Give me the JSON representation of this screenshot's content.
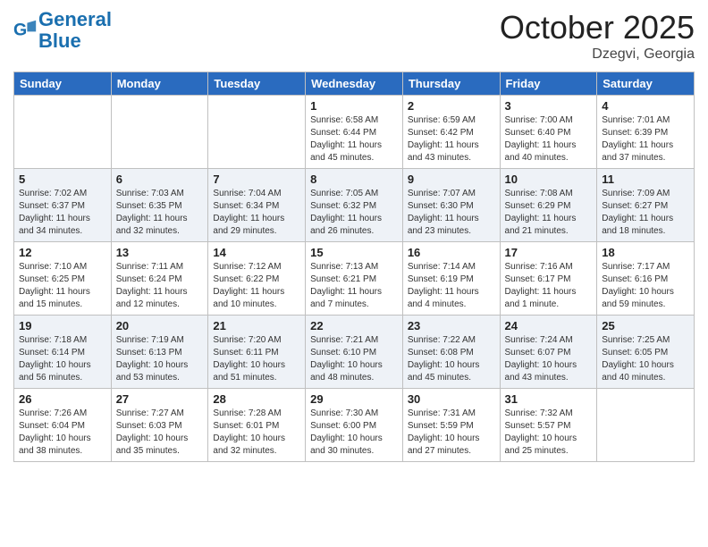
{
  "header": {
    "logo_general": "General",
    "logo_blue": "Blue",
    "month": "October 2025",
    "location": "Dzegvi, Georgia"
  },
  "weekdays": [
    "Sunday",
    "Monday",
    "Tuesday",
    "Wednesday",
    "Thursday",
    "Friday",
    "Saturday"
  ],
  "weeks": [
    [
      {
        "day": "",
        "info": ""
      },
      {
        "day": "",
        "info": ""
      },
      {
        "day": "",
        "info": ""
      },
      {
        "day": "1",
        "info": "Sunrise: 6:58 AM\nSunset: 6:44 PM\nDaylight: 11 hours\nand 45 minutes."
      },
      {
        "day": "2",
        "info": "Sunrise: 6:59 AM\nSunset: 6:42 PM\nDaylight: 11 hours\nand 43 minutes."
      },
      {
        "day": "3",
        "info": "Sunrise: 7:00 AM\nSunset: 6:40 PM\nDaylight: 11 hours\nand 40 minutes."
      },
      {
        "day": "4",
        "info": "Sunrise: 7:01 AM\nSunset: 6:39 PM\nDaylight: 11 hours\nand 37 minutes."
      }
    ],
    [
      {
        "day": "5",
        "info": "Sunrise: 7:02 AM\nSunset: 6:37 PM\nDaylight: 11 hours\nand 34 minutes."
      },
      {
        "day": "6",
        "info": "Sunrise: 7:03 AM\nSunset: 6:35 PM\nDaylight: 11 hours\nand 32 minutes."
      },
      {
        "day": "7",
        "info": "Sunrise: 7:04 AM\nSunset: 6:34 PM\nDaylight: 11 hours\nand 29 minutes."
      },
      {
        "day": "8",
        "info": "Sunrise: 7:05 AM\nSunset: 6:32 PM\nDaylight: 11 hours\nand 26 minutes."
      },
      {
        "day": "9",
        "info": "Sunrise: 7:07 AM\nSunset: 6:30 PM\nDaylight: 11 hours\nand 23 minutes."
      },
      {
        "day": "10",
        "info": "Sunrise: 7:08 AM\nSunset: 6:29 PM\nDaylight: 11 hours\nand 21 minutes."
      },
      {
        "day": "11",
        "info": "Sunrise: 7:09 AM\nSunset: 6:27 PM\nDaylight: 11 hours\nand 18 minutes."
      }
    ],
    [
      {
        "day": "12",
        "info": "Sunrise: 7:10 AM\nSunset: 6:25 PM\nDaylight: 11 hours\nand 15 minutes."
      },
      {
        "day": "13",
        "info": "Sunrise: 7:11 AM\nSunset: 6:24 PM\nDaylight: 11 hours\nand 12 minutes."
      },
      {
        "day": "14",
        "info": "Sunrise: 7:12 AM\nSunset: 6:22 PM\nDaylight: 11 hours\nand 10 minutes."
      },
      {
        "day": "15",
        "info": "Sunrise: 7:13 AM\nSunset: 6:21 PM\nDaylight: 11 hours\nand 7 minutes."
      },
      {
        "day": "16",
        "info": "Sunrise: 7:14 AM\nSunset: 6:19 PM\nDaylight: 11 hours\nand 4 minutes."
      },
      {
        "day": "17",
        "info": "Sunrise: 7:16 AM\nSunset: 6:17 PM\nDaylight: 11 hours\nand 1 minute."
      },
      {
        "day": "18",
        "info": "Sunrise: 7:17 AM\nSunset: 6:16 PM\nDaylight: 10 hours\nand 59 minutes."
      }
    ],
    [
      {
        "day": "19",
        "info": "Sunrise: 7:18 AM\nSunset: 6:14 PM\nDaylight: 10 hours\nand 56 minutes."
      },
      {
        "day": "20",
        "info": "Sunrise: 7:19 AM\nSunset: 6:13 PM\nDaylight: 10 hours\nand 53 minutes."
      },
      {
        "day": "21",
        "info": "Sunrise: 7:20 AM\nSunset: 6:11 PM\nDaylight: 10 hours\nand 51 minutes."
      },
      {
        "day": "22",
        "info": "Sunrise: 7:21 AM\nSunset: 6:10 PM\nDaylight: 10 hours\nand 48 minutes."
      },
      {
        "day": "23",
        "info": "Sunrise: 7:22 AM\nSunset: 6:08 PM\nDaylight: 10 hours\nand 45 minutes."
      },
      {
        "day": "24",
        "info": "Sunrise: 7:24 AM\nSunset: 6:07 PM\nDaylight: 10 hours\nand 43 minutes."
      },
      {
        "day": "25",
        "info": "Sunrise: 7:25 AM\nSunset: 6:05 PM\nDaylight: 10 hours\nand 40 minutes."
      }
    ],
    [
      {
        "day": "26",
        "info": "Sunrise: 7:26 AM\nSunset: 6:04 PM\nDaylight: 10 hours\nand 38 minutes."
      },
      {
        "day": "27",
        "info": "Sunrise: 7:27 AM\nSunset: 6:03 PM\nDaylight: 10 hours\nand 35 minutes."
      },
      {
        "day": "28",
        "info": "Sunrise: 7:28 AM\nSunset: 6:01 PM\nDaylight: 10 hours\nand 32 minutes."
      },
      {
        "day": "29",
        "info": "Sunrise: 7:30 AM\nSunset: 6:00 PM\nDaylight: 10 hours\nand 30 minutes."
      },
      {
        "day": "30",
        "info": "Sunrise: 7:31 AM\nSunset: 5:59 PM\nDaylight: 10 hours\nand 27 minutes."
      },
      {
        "day": "31",
        "info": "Sunrise: 7:32 AM\nSunset: 5:57 PM\nDaylight: 10 hours\nand 25 minutes."
      },
      {
        "day": "",
        "info": ""
      }
    ]
  ]
}
